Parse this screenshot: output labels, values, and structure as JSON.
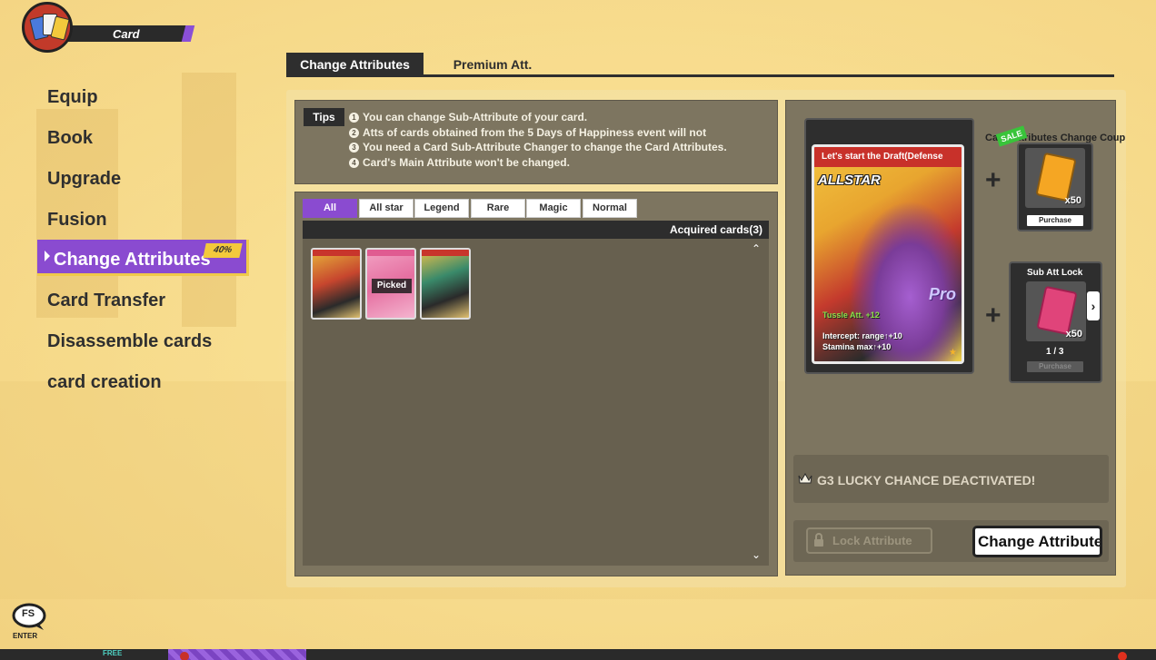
{
  "header": {
    "title": "Card"
  },
  "sidebar": {
    "items": [
      {
        "label": "Equip"
      },
      {
        "label": "Book"
      },
      {
        "label": "Upgrade"
      },
      {
        "label": "Fusion"
      },
      {
        "label": "Change Attributes",
        "badge": "40%",
        "active": true
      },
      {
        "label": "Card Transfer"
      },
      {
        "label": "Disassemble cards"
      },
      {
        "label": "card creation"
      }
    ]
  },
  "tabs": [
    {
      "label": "Change Attributes",
      "active": true
    },
    {
      "label": "Premium Att.",
      "active": false
    }
  ],
  "tips": {
    "label": "Tips",
    "lines": [
      "You can change Sub-Attribute of your card.",
      "Atts of cards obtained from the 5 Days of Happiness event will not",
      "You need a Card Sub-Attribute Changer to change the Card Attributes.",
      "Card's Main Attribute won't be changed."
    ],
    "numbers": [
      "1",
      "2",
      "3",
      "4"
    ]
  },
  "filters": [
    "All",
    "All star",
    "Legend",
    "Rare",
    "Magic",
    "Normal"
  ],
  "acquired": {
    "label": "Acquired cards(3)",
    "picked_label": "Picked"
  },
  "selected_card": {
    "title": "Let's start the Draft(Defense",
    "series": "ALLSTAR",
    "grade": "Pro",
    "main_att": "Tussle Att. +12",
    "sub_atts": [
      "Intercept: range↑+10",
      "Stamina max↑+10"
    ]
  },
  "coupon": {
    "title": "Card Attributes Change Coupo",
    "sale": "SALE",
    "count": "x50",
    "purchase": "Purchase"
  },
  "sub_att_lock": {
    "title": "Sub Att Lock",
    "count": "x50",
    "progress": "1 / 3",
    "purchase": "Purchase"
  },
  "lucky": {
    "text": "G3 LUCKY CHANCE DEACTIVATED!"
  },
  "actions": {
    "lock_label": "Lock Attribute",
    "change_label": "Change Attributes"
  },
  "bottom": {
    "fs_label": "FS",
    "enter_label": "ENTER",
    "free_label": "FREE"
  },
  "colors": {
    "accent_purple": "#8a4bd0",
    "panel": "#7d7560",
    "background": "#f7dc8e",
    "sale_green": "#39c43a"
  }
}
